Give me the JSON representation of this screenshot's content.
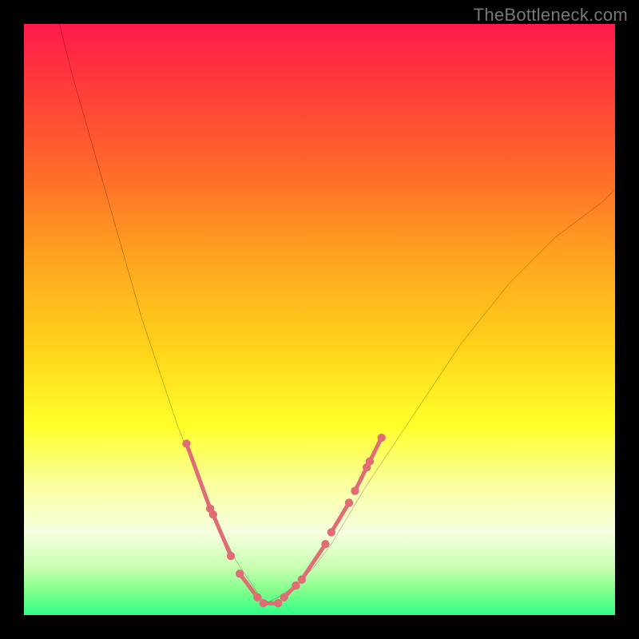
{
  "watermark": "TheBottleneck.com",
  "chart_data": {
    "type": "line",
    "title": "",
    "xlabel": "",
    "ylabel": "",
    "xlim": [
      0,
      100
    ],
    "ylim": [
      0,
      100
    ],
    "grid": false,
    "legend": "none",
    "background_gradient_stops": [
      {
        "offset": 0.0,
        "color": "#ff1a4d"
      },
      {
        "offset": 0.1,
        "color": "#ff3a3a"
      },
      {
        "offset": 0.25,
        "color": "#ff6a2a"
      },
      {
        "offset": 0.4,
        "color": "#ffa61f"
      },
      {
        "offset": 0.55,
        "color": "#ffd31a"
      },
      {
        "offset": 0.68,
        "color": "#ffff2a"
      },
      {
        "offset": 0.78,
        "color": "#faffa0"
      },
      {
        "offset": 0.86,
        "color": "#f6ffe0"
      },
      {
        "offset": 0.92,
        "color": "#c8ffb0"
      },
      {
        "offset": 0.96,
        "color": "#7fff8a"
      },
      {
        "offset": 1.0,
        "color": "#2fff88"
      }
    ],
    "series": [
      {
        "name": "curve-left",
        "stroke": "#000000",
        "stroke_width": 1.8,
        "x": [
          6,
          8,
          10,
          12,
          14,
          16,
          18,
          20,
          22,
          24,
          26,
          28,
          30,
          32,
          34,
          36,
          38,
          40,
          41
        ],
        "y": [
          100,
          92,
          85,
          78,
          71,
          64,
          57,
          50,
          44,
          38,
          32,
          27,
          22,
          17,
          13,
          9,
          6,
          3,
          2
        ]
      },
      {
        "name": "curve-right",
        "stroke": "#000000",
        "stroke_width": 1.8,
        "x": [
          41,
          43,
          46,
          49,
          52,
          55,
          58,
          62,
          66,
          70,
          74,
          78,
          82,
          86,
          90,
          94,
          98,
          100
        ],
        "y": [
          2,
          3,
          5,
          8,
          12,
          17,
          22,
          28,
          34,
          40,
          46,
          51,
          56,
          60,
          64,
          67,
          70,
          72
        ]
      },
      {
        "name": "highlight-segments",
        "stroke": "#e06c75",
        "stroke_width": 5,
        "dotted_ends": true,
        "segments": [
          {
            "x": [
              27.5,
              31.5
            ],
            "y": [
              29,
              18
            ]
          },
          {
            "x": [
              32.0,
              35.0
            ],
            "y": [
              17,
              10
            ]
          },
          {
            "x": [
              36.5,
              39.5
            ],
            "y": [
              7,
              3
            ]
          },
          {
            "x": [
              40.5,
              43.0
            ],
            "y": [
              2,
              2
            ]
          },
          {
            "x": [
              44.0,
              46.0
            ],
            "y": [
              3,
              5
            ]
          },
          {
            "x": [
              47.0,
              51.0
            ],
            "y": [
              6,
              12
            ]
          },
          {
            "x": [
              52.0,
              55.0
            ],
            "y": [
              14,
              19
            ]
          },
          {
            "x": [
              56.0,
              58.0
            ],
            "y": [
              21,
              25
            ]
          },
          {
            "x": [
              58.5,
              60.5
            ],
            "y": [
              26,
              30
            ]
          }
        ]
      }
    ]
  }
}
